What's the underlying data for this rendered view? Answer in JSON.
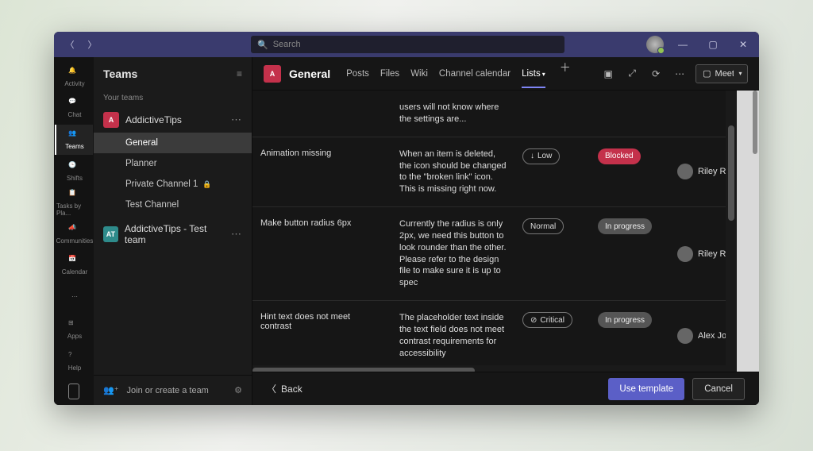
{
  "titlebar": {
    "search_placeholder": "Search"
  },
  "rail": {
    "items": [
      {
        "label": "Activity"
      },
      {
        "label": "Chat"
      },
      {
        "label": "Teams"
      },
      {
        "label": "Shifts"
      },
      {
        "label": "Tasks by Pla..."
      },
      {
        "label": "Communities"
      },
      {
        "label": "Calendar"
      }
    ],
    "apps": "Apps",
    "help": "Help"
  },
  "sidepanel": {
    "title": "Teams",
    "your_teams": "Your teams",
    "teams": [
      {
        "initial": "A",
        "color": "#c4314b",
        "name": "AddictiveTips",
        "channels": [
          "General",
          "Planner",
          "Private Channel 1",
          "Test Channel"
        ],
        "private": [
          false,
          false,
          true,
          false
        ]
      },
      {
        "initial": "AT",
        "color": "#2e8b8b",
        "name": "AddictiveTips - Test team",
        "channels": []
      }
    ],
    "join": "Join or create a team"
  },
  "chanbar": {
    "initial": "A",
    "name": "General",
    "tabs": [
      "Posts",
      "Files",
      "Wiki",
      "Channel calendar",
      "Lists"
    ],
    "active": 4,
    "meet": "Meet"
  },
  "list": {
    "rows": [
      {
        "title": "",
        "desc": "users will not know where the settings are...",
        "priority": "",
        "status": "",
        "assignee": ""
      },
      {
        "title": "Animation missing",
        "desc": "When an item is deleted, the icon should be changed to the \"broken link\" icon. This is missing right now.",
        "priority": "Low",
        "pri_icon": "↓",
        "status": "Blocked",
        "status_kind": "blocked",
        "assignee": "Riley Ran"
      },
      {
        "title": "Make button radius 6px",
        "desc": "Currently the radius is only 2px, we need this button to look rounder than the other. Please refer to the design file to make sure it is up to spec",
        "priority": "Normal",
        "pri_icon": "",
        "status": "In progress",
        "status_kind": "progress",
        "assignee": "Riley Ran"
      },
      {
        "title": "Hint text does not meet contrast",
        "desc": "The placeholder text inside the text field does not meet contrast requirements for accessibility",
        "priority": "Critical",
        "pri_icon": "⊘",
        "status": "In progress",
        "status_kind": "progress",
        "assignee": "Alex John"
      }
    ]
  },
  "footer": {
    "back": "Back",
    "primary": "Use template",
    "cancel": "Cancel"
  }
}
